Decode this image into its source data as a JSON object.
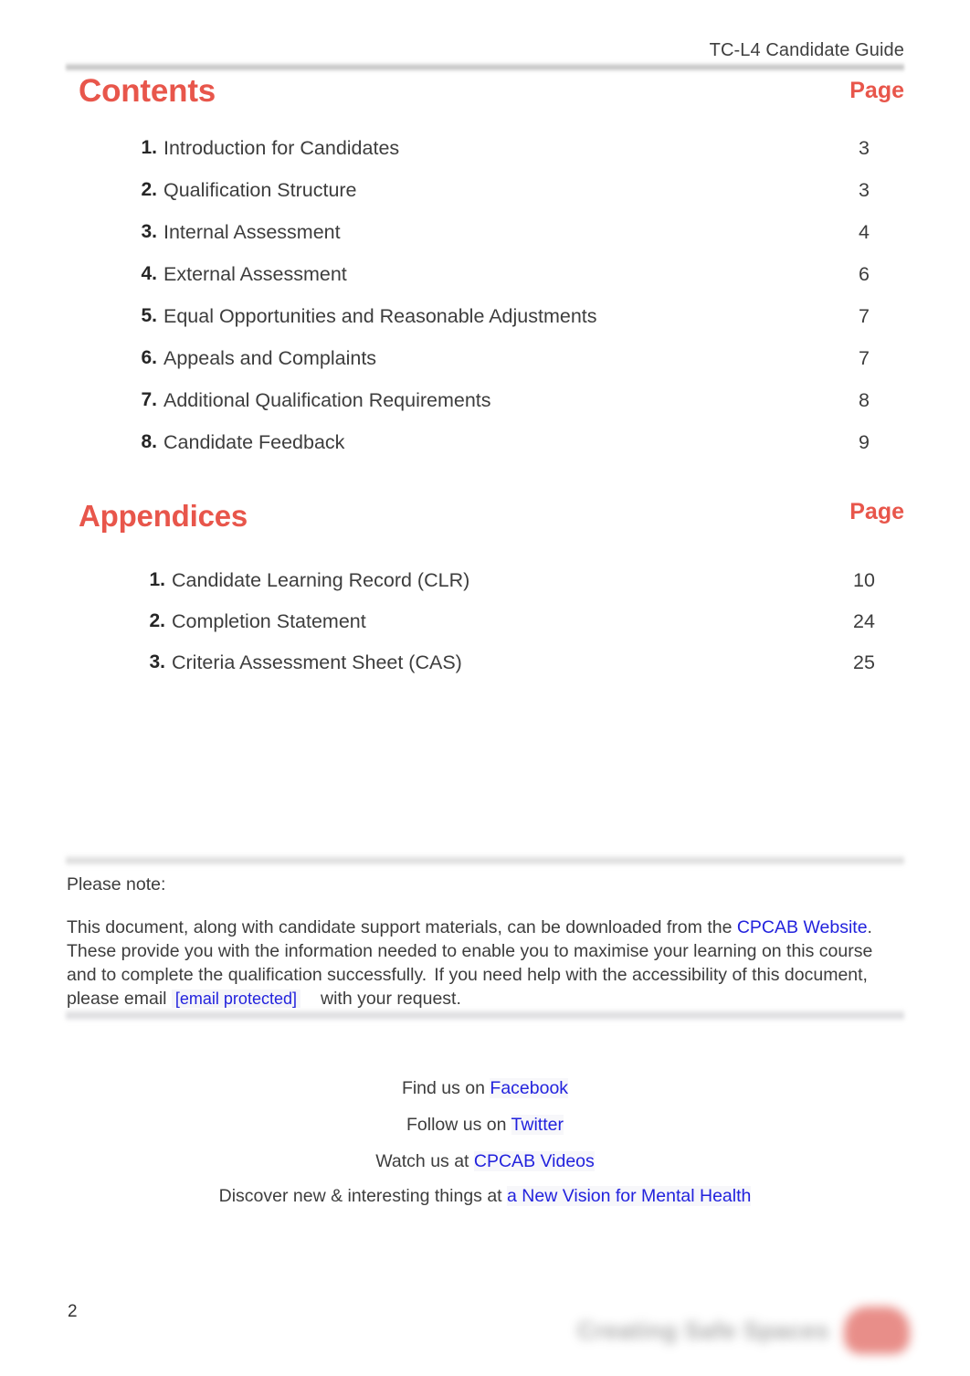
{
  "header": {
    "running_title": "TC-L4 Candidate Guide"
  },
  "contents": {
    "title": "Contents",
    "page_column_label": "Page",
    "items": [
      {
        "num": "1.",
        "label": "Introduction for Candidates",
        "page": "3"
      },
      {
        "num": "2.",
        "label": "Qualification Structure",
        "page": "3"
      },
      {
        "num": "3.",
        "label": "Internal Assessment",
        "page": "4"
      },
      {
        "num": "4.",
        "label": "External Assessment",
        "page": "6"
      },
      {
        "num": "5.",
        "label": "Equal Opportunities and Reasonable Adjustments",
        "page": "7"
      },
      {
        "num": "6.",
        "label": "Appeals and Complaints",
        "page": "7"
      },
      {
        "num": "7.",
        "label": "Additional Qualification Requirements",
        "page": "8"
      },
      {
        "num": "8.",
        "label": "Candidate Feedback",
        "page": "9"
      }
    ]
  },
  "appendices": {
    "title": "Appendices",
    "page_column_label": "Page",
    "items": [
      {
        "num": "1.",
        "label": "Candidate Learning Record (CLR)",
        "page": "10"
      },
      {
        "num": "2.",
        "label": "Completion Statement",
        "page": "24"
      },
      {
        "num": "3.",
        "label": "Criteria Assessment Sheet (CAS)",
        "page": "25"
      }
    ]
  },
  "note": {
    "lead": "Please note:",
    "text_1": "This document, along with candidate support materials, can be downloaded from the ",
    "link_website": "CPCAB Website",
    "text_2": ". These provide you with the information needed to enable you to maximise your learning on this course and to complete the qualification successfully.",
    "text_3": "If you need help with the accessibility of this document, please email",
    "link_email": "[email protected]",
    "text_4": "with your request."
  },
  "social": {
    "line_1_prefix": "Find us on ",
    "line_1_link": "Facebook",
    "line_2_prefix": "Follow us on ",
    "line_2_link": "Twitter",
    "line_3_prefix": "Watch us at ",
    "line_3_link": "CPCAB Videos",
    "line_4_prefix": "Discover new & interesting things at ",
    "line_4_link": "a New Vision for Mental Health"
  },
  "footer": {
    "page_number": "2",
    "logo_text": "Creating Safe Spaces"
  },
  "colors": {
    "accent_red": "#e8564b",
    "link_blue": "#2222dd",
    "body_text": "#3d3d3d",
    "rule_gray": "#b2b2b2"
  }
}
